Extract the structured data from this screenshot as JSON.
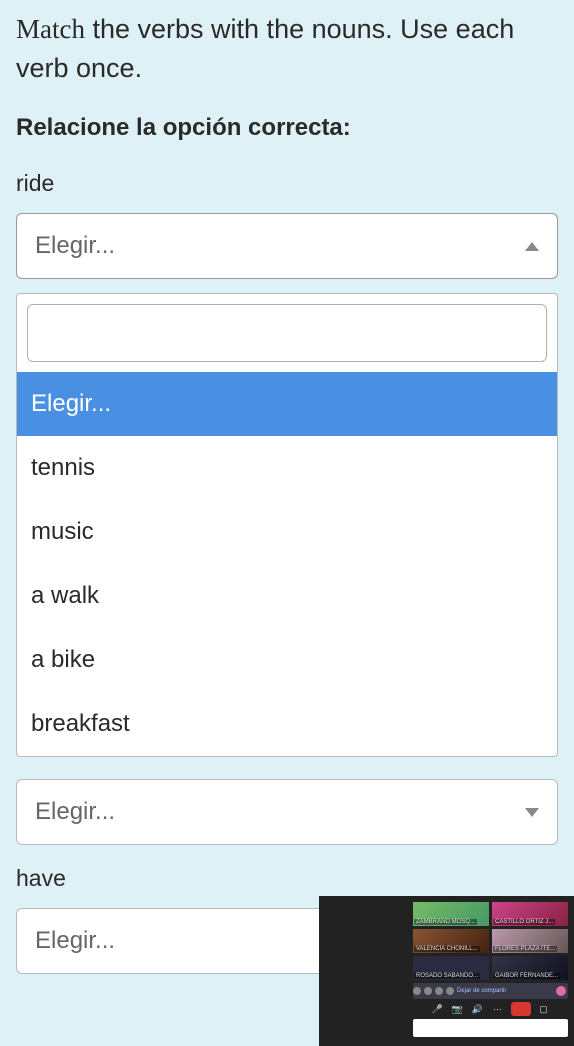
{
  "instruction_prefix": "Match",
  "instruction_rest": " the verbs with the nouns. Use each verb once.",
  "subheading": "Relacione la opción correcta:",
  "placeholder": "Elegir...",
  "items": [
    {
      "label": "ride"
    },
    {
      "label": "have"
    }
  ],
  "dropdown": {
    "search_value": "",
    "options": [
      {
        "text": "Elegir...",
        "highlighted": true
      },
      {
        "text": "tennis",
        "highlighted": false
      },
      {
        "text": "music",
        "highlighted": false
      },
      {
        "text": "a walk",
        "highlighted": false
      },
      {
        "text": "a bike",
        "highlighted": false
      },
      {
        "text": "breakfast",
        "highlighted": false
      }
    ]
  },
  "video": {
    "tiles": [
      {
        "name": "ZAMBRANO MOSQ..."
      },
      {
        "name": "CASTILLO ORTIZ J..."
      },
      {
        "name": "VALENCIA CHONILL..."
      },
      {
        "name": "FLORES PLAZA ITE..."
      },
      {
        "name": "ROSADO SABANDO..."
      },
      {
        "name": "GAIBOR FERNANDE..."
      }
    ],
    "share_label": "Dejar de compartir"
  }
}
